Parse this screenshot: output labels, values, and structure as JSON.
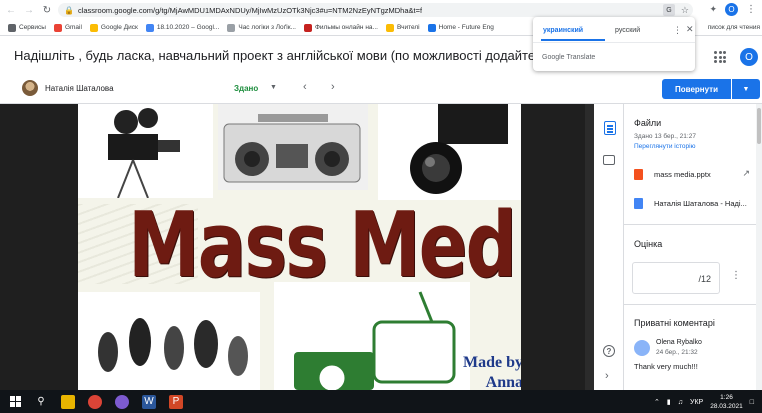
{
  "browser": {
    "url": "classroom.google.com/g/tg/MjAwMDU1MDAxNDUy/MjIwMzUzOTk3Njc3#u=NTM2NzEyNTgzMDha&t=f",
    "profile_initial": "O",
    "bookmarks": [
      "Сервисы",
      "Gmail",
      "Google Диск",
      "18.10.2020 – Googl...",
      "Час логіки з Лоґік...",
      "Фильмы онлайн на...",
      "Вчителі",
      "Home - Future Eng"
    ],
    "bookmarks_right": "писок для чтения"
  },
  "translate_popup": {
    "active_language": "украинский",
    "other_language": "русский",
    "brand": "Google Translate"
  },
  "header": {
    "title": "Надішліть , будь ласка, навчальний проект з англійської мови (по можливості додайте фото, від",
    "account_initial": "O"
  },
  "student_bar": {
    "student_name": "Наталія Шаталова",
    "status": "Здано",
    "return_button": "Повернути"
  },
  "slide": {
    "title": "Mass Media",
    "made_by_line1": "Made by",
    "made_by_line2": "Anna"
  },
  "side_panel": {
    "files_title": "Файли",
    "submitted_date": "Здано 13 бер., 21:27",
    "history_link": "Переглянути історію",
    "files": [
      {
        "name": "mass media.pptx",
        "type": "ppt"
      },
      {
        "name": "Наталія Шаталова - Наді...",
        "type": "doc"
      }
    ],
    "grade_title": "Оцінка",
    "grade_denominator": "/12",
    "comments_title": "Приватні коментарі",
    "comment": {
      "author": "Olena Rybalko",
      "time": "24 бер., 21:32",
      "text": "Thank very much!!!"
    }
  },
  "taskbar": {
    "language": "УКР",
    "time": "1:26",
    "date": "28.03.2021"
  },
  "colors": {
    "accent": "#1a73e8",
    "status_green": "#1e8e3e",
    "slide_title": "#6e1b12"
  }
}
